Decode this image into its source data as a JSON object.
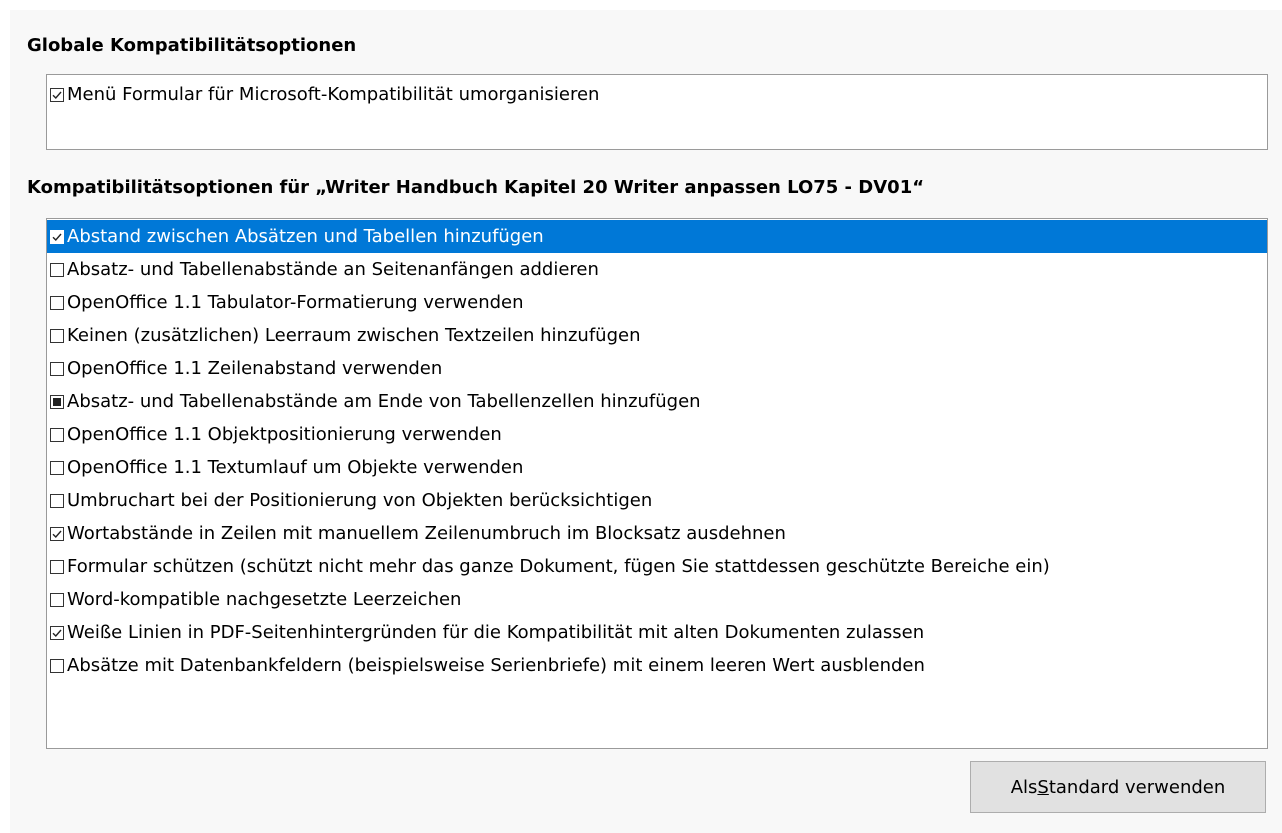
{
  "global": {
    "heading": "Globale Kompatibilitätsoptionen",
    "options": [
      {
        "label": "Menü Formular für Microsoft-Kompatibilität umorganisieren",
        "state": "checked"
      }
    ]
  },
  "document": {
    "heading": "Kompatibilitätsoptionen für „Writer Handbuch Kapitel 20 Writer anpassen LO75 - DV01“",
    "options": [
      {
        "label": "Abstand zwischen Absätzen und Tabellen hinzufügen",
        "state": "checked",
        "selected": true
      },
      {
        "label": "Absatz- und Tabellenabstände an Seitenanfängen addieren",
        "state": "unchecked"
      },
      {
        "label": "OpenOffice 1.1 Tabulator-Formatierung verwenden",
        "state": "unchecked"
      },
      {
        "label": "Keinen (zusätzlichen) Leerraum zwischen Textzeilen hinzufügen",
        "state": "unchecked"
      },
      {
        "label": "OpenOffice 1.1 Zeilenabstand verwenden",
        "state": "unchecked"
      },
      {
        "label": "Absatz- und Tabellenabstände am Ende von Tabellenzellen hinzufügen",
        "state": "tristate"
      },
      {
        "label": "OpenOffice 1.1 Objektpositionierung verwenden",
        "state": "unchecked"
      },
      {
        "label": "OpenOffice 1.1 Textumlauf um Objekte verwenden",
        "state": "unchecked"
      },
      {
        "label": "Umbruchart bei der Positionierung von Objekten berücksichtigen",
        "state": "unchecked"
      },
      {
        "label": "Wortabstände in Zeilen mit manuellem Zeilenumbruch im Blocksatz ausdehnen",
        "state": "checked"
      },
      {
        "label": "Formular schützen (schützt nicht mehr das ganze Dokument, fügen Sie stattdessen geschützte Bereiche ein)",
        "state": "unchecked"
      },
      {
        "label": "Word-kompatible nachgesetzte Leerzeichen",
        "state": "unchecked"
      },
      {
        "label": "Weiße Linien in PDF-Seitenhintergründen für die Kompatibilität mit alten Dokumenten zulassen",
        "state": "checked"
      },
      {
        "label": "Absätze mit Datenbankfeldern (beispielsweise Serienbriefe) mit einem leeren Wert ausblenden",
        "state": "unchecked"
      }
    ]
  },
  "button": {
    "label_before": "Als ",
    "label_mnemonic": "S",
    "label_after": "tandard verwenden"
  },
  "colors": {
    "selection": "#0078d7",
    "panel": "#f8f8f8",
    "button": "#e1e1e1"
  }
}
